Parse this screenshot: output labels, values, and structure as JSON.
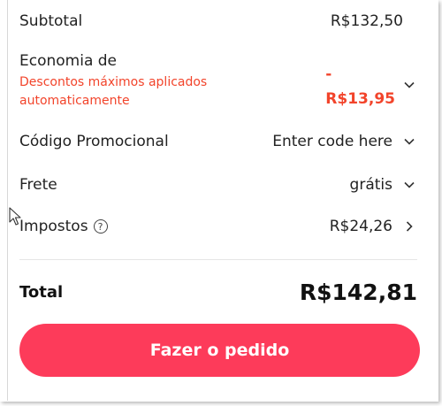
{
  "summary": {
    "subtotal": {
      "label": "Subtotal",
      "value": "R$132,50"
    },
    "discount": {
      "label": "Economia de",
      "note": "Descontos máximos aplicados automaticamente",
      "sign": "-",
      "value": "R$13,95",
      "icon": "chevron-down-icon"
    },
    "promo": {
      "label": "Código Promocional",
      "value": "Enter code here",
      "icon": "chevron-down-icon"
    },
    "shipping": {
      "label": "Frete",
      "value": "grátis",
      "icon": "chevron-down-icon"
    },
    "taxes": {
      "label": "Impostos",
      "help": "?",
      "value": "R$24,26",
      "icon": "chevron-right-icon"
    }
  },
  "total": {
    "label": "Total",
    "value": "R$142,81"
  },
  "actions": {
    "order_label": "Fazer o pedido"
  },
  "colors": {
    "accent": "#fd3b5a",
    "discount": "#f2442b",
    "text": "#222222"
  }
}
